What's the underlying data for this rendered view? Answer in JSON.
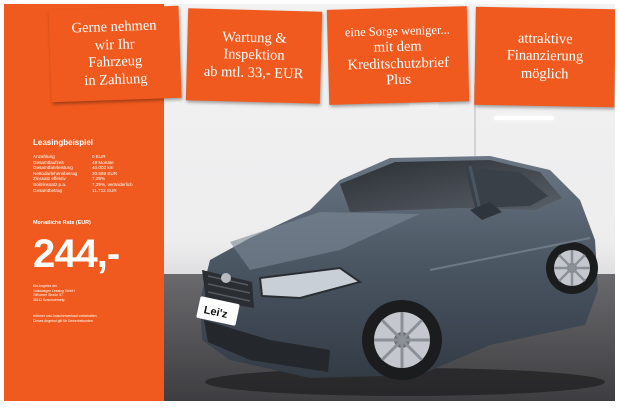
{
  "banners": [
    {
      "lines": [
        "Gerne nehmen",
        "wir Ihr",
        "Fahrzeug",
        "in Zahlung"
      ]
    },
    {
      "lines": [
        "Wartung &",
        "Inspektion",
        "ab mtl. 33,- EUR"
      ]
    },
    {
      "lines": [
        "eine Sorge weniger...",
        "mit dem",
        "Kreditschutzbrief",
        "Plus"
      ]
    },
    {
      "lines": [
        "attraktive",
        "Finanzierung",
        "möglich"
      ]
    }
  ],
  "leasing": {
    "title": "Leasingbeispiel",
    "specs": [
      {
        "label": "Anzahlung",
        "value": "0 EUR"
      },
      {
        "label": "Gesamtlaufzeit",
        "value": "48 Monate"
      },
      {
        "label": "Gesamtfahrleistung",
        "value": "40.000 km"
      },
      {
        "label": "Nettodarlehensbetrag",
        "value": "20.669 EUR"
      },
      {
        "label": "Zinssatz effektiv",
        "value": "7,29%"
      },
      {
        "label": "Sollzinssatz p.a.",
        "value": "7,29%, veränderlich"
      },
      {
        "label": "Gesamtbetrag",
        "value": "11.712 EUR"
      }
    ],
    "rate_label": "Monatliche Rate (EUR)",
    "price": "244,-",
    "provider_lines": [
      "Ein Angebot der",
      "Volkswagen Leasing GmbH",
      "Gifhorner Straße 57",
      "38112 Braunschweig"
    ],
    "disclaimer_lines": [
      "Irrtümer und Zwischenverkauf vorbehalten.",
      "Dieses Angebot gilt für Gewerbekunden."
    ]
  },
  "car": {
    "plate_text": "Lei'z",
    "body_color": "#4a5562",
    "logo_letter": "S"
  },
  "colors": {
    "accent_orange": "#f05a1e",
    "text_white": "#ffffff"
  }
}
